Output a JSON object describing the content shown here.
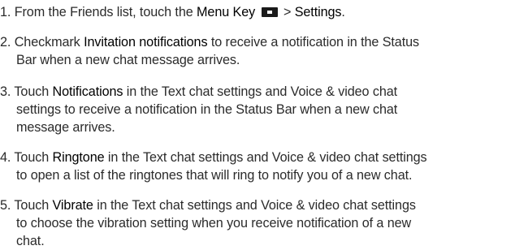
{
  "steps": [
    {
      "number": "1.",
      "lines": [
        {
          "pre": "From the Friends list, touch the ",
          "key1": "Menu Key",
          "mid": " > ",
          "key2": "Settings",
          "post": "."
        }
      ]
    },
    {
      "number": "2.",
      "lines": [
        {
          "pre": "Checkmark ",
          "key": "Invitation notifications",
          "post": " to receive a notification in the Status"
        },
        {
          "text": "Bar when a new chat message arrives."
        }
      ]
    },
    {
      "number": "3.",
      "lines": [
        {
          "pre": "Touch ",
          "key": "Notifications",
          "post": " in the Text chat settings and Voice & video chat"
        },
        {
          "text": "settings to receive a notification in the Status Bar when a new chat"
        },
        {
          "text": "message arrives."
        }
      ]
    },
    {
      "number": "4.",
      "lines": [
        {
          "pre": "Touch ",
          "key": "Ringtone",
          "post": " in the Text chat settings and Voice & video chat settings"
        },
        {
          "text": "to open a list of the ringtones that will ring to notify you of a new chat."
        }
      ]
    },
    {
      "number": "5.",
      "lines": [
        {
          "pre": "Touch ",
          "key": "Vibrate",
          "post": " in the Text chat settings and Voice & video chat settings"
        },
        {
          "text": "to choose the vibration setting when you receive notification of a new"
        },
        {
          "text": "chat."
        }
      ]
    }
  ],
  "icons": {
    "menu_key": "menu-key-icon"
  }
}
